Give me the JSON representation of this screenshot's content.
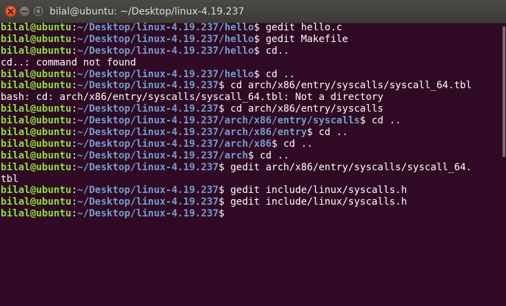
{
  "window": {
    "title": "bilal@ubuntu: ~/Desktop/linux-4.19.237"
  },
  "colors": {
    "background": "#300a24",
    "user_host": "#8ae234",
    "path": "#729fcf",
    "text": "#ffffff"
  },
  "icons": [
    "close-icon",
    "minimize-icon",
    "maximize-icon"
  ],
  "terminal": {
    "lines": [
      {
        "type": "prompt",
        "user": "bilal@ubuntu",
        "sep": ":",
        "path": "~/Desktop/linux-4.19.237/hello",
        "cmd": "$ gedit hello.c"
      },
      {
        "type": "prompt",
        "user": "bilal@ubuntu",
        "sep": ":",
        "path": "~/Desktop/linux-4.19.237/hello",
        "cmd": "$ gedit Makefile"
      },
      {
        "type": "prompt",
        "user": "bilal@ubuntu",
        "sep": ":",
        "path": "~/Desktop/linux-4.19.237/hello",
        "cmd": "$ cd.."
      },
      {
        "type": "output",
        "text": "cd..: command not found"
      },
      {
        "type": "prompt",
        "user": "bilal@ubuntu",
        "sep": ":",
        "path": "~/Desktop/linux-4.19.237/hello",
        "cmd": "$ cd .."
      },
      {
        "type": "prompt",
        "user": "bilal@ubuntu",
        "sep": ":",
        "path": "~/Desktop/linux-4.19.237",
        "cmd": "$ cd arch/x86/entry/syscalls/syscall_64.tbl"
      },
      {
        "type": "output",
        "text": "bash: cd: arch/x86/entry/syscalls/syscall_64.tbl: Not a directory"
      },
      {
        "type": "prompt",
        "user": "bilal@ubuntu",
        "sep": ":",
        "path": "~/Desktop/linux-4.19.237",
        "cmd": "$ cd arch/x86/entry/syscalls"
      },
      {
        "type": "prompt",
        "user": "bilal@ubuntu",
        "sep": ":",
        "path": "~/Desktop/linux-4.19.237/arch/x86/entry/syscalls",
        "cmd": "$ cd .."
      },
      {
        "type": "prompt",
        "user": "bilal@ubuntu",
        "sep": ":",
        "path": "~/Desktop/linux-4.19.237/arch/x86/entry",
        "cmd": "$ cd .."
      },
      {
        "type": "prompt",
        "user": "bilal@ubuntu",
        "sep": ":",
        "path": "~/Desktop/linux-4.19.237/arch/x86",
        "cmd": "$ cd .."
      },
      {
        "type": "prompt",
        "user": "bilal@ubuntu",
        "sep": ":",
        "path": "~/Desktop/linux-4.19.237/arch",
        "cmd": "$ cd .."
      },
      {
        "type": "prompt",
        "user": "bilal@ubuntu",
        "sep": ":",
        "path": "~/Desktop/linux-4.19.237",
        "cmd": "$ gedit arch/x86/entry/syscalls/syscall_64."
      },
      {
        "type": "output",
        "text": "tbl"
      },
      {
        "type": "prompt",
        "user": "bilal@ubuntu",
        "sep": ":",
        "path": "~/Desktop/linux-4.19.237",
        "cmd": "$ gedit include/linux/syscalls.h"
      },
      {
        "type": "prompt",
        "user": "bilal@ubuntu",
        "sep": ":",
        "path": "~/Desktop/linux-4.19.237",
        "cmd": "$ gedit include/linux/syscalls.h"
      },
      {
        "type": "prompt",
        "user": "bilal@ubuntu",
        "sep": ":",
        "path": "~/Desktop/linux-4.19.237",
        "cmd": "$ "
      }
    ]
  }
}
